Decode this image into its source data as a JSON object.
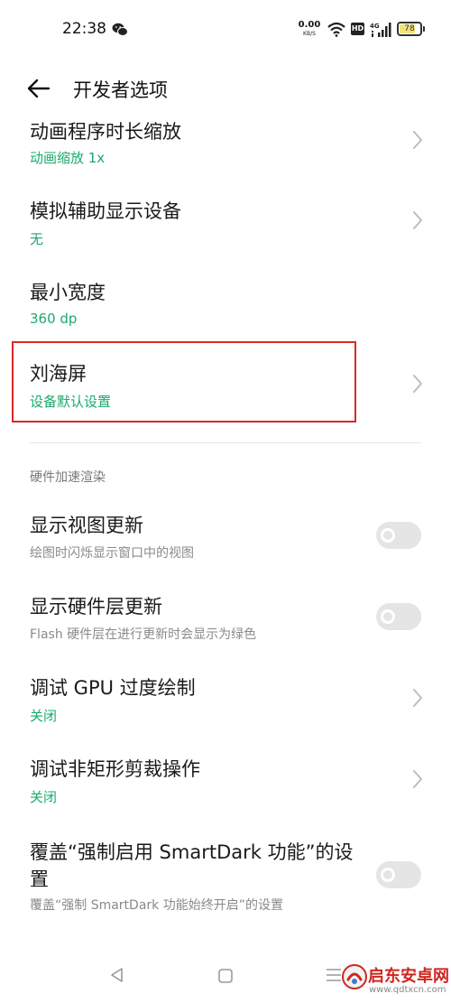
{
  "status_bar": {
    "time": "22:38",
    "net_speed_value": "0.00",
    "net_speed_unit": "KB/S",
    "hd_label": "HD",
    "battery_level": "78",
    "battery_fraction": 0.78,
    "icons": [
      "wechat-icon",
      "wifi-icon",
      "signal-4g-icon",
      "battery-icon"
    ]
  },
  "header": {
    "title": "开发者选项",
    "back_icon": "back-arrow-icon"
  },
  "items": [
    {
      "title": "动画程序时长缩放",
      "value": "动画缩放 1x",
      "control": "chevron"
    },
    {
      "title": "模拟辅助显示设备",
      "value": "无",
      "control": "chevron"
    },
    {
      "title": "最小宽度",
      "value": "360 dp",
      "control": "none"
    },
    {
      "title": "刘海屏",
      "value": "设备默认设置",
      "control": "chevron",
      "highlighted": true
    }
  ],
  "section": {
    "title": "硬件加速渲染",
    "items": [
      {
        "title": "显示视图更新",
        "description": "绘图时闪烁显示窗口中的视图",
        "control": "toggle",
        "enabled": false
      },
      {
        "title": "显示硬件层更新",
        "description": "Flash 硬件层在进行更新时会显示为绿色",
        "control": "toggle",
        "enabled": false
      },
      {
        "title": "调试 GPU 过度绘制",
        "value": "关闭",
        "control": "chevron"
      },
      {
        "title": "调试非矩形剪裁操作",
        "value": "关闭",
        "control": "chevron"
      },
      {
        "title_line1": "覆盖“强制启用 SmartDark 功能”的设",
        "title_line2": "置",
        "description": "覆盖“强制 SmartDark 功能始终开启”的设置",
        "control": "toggle",
        "enabled": false
      }
    ]
  },
  "nav_bar": {
    "icons": [
      "nav-back-icon",
      "nav-home-icon",
      "nav-menu-icon"
    ]
  },
  "watermark": {
    "text": "启东安卓网",
    "url": "www.qdtxcn.com"
  },
  "colors": {
    "accent": "#1aaa6d",
    "highlight": "#d62a2a",
    "toggle_off": "#e5e5e5",
    "watermark": "#d0261e"
  }
}
